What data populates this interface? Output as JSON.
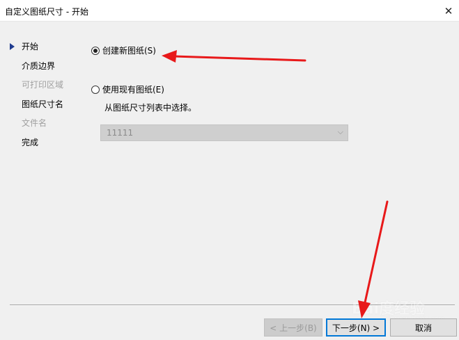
{
  "window": {
    "title": "自定义图纸尺寸 - 开始",
    "close_glyph": "✕"
  },
  "steps": [
    {
      "label": "开始",
      "state": "current"
    },
    {
      "label": "介质边界",
      "state": "enabled"
    },
    {
      "label": "可打印区域",
      "state": "disabled"
    },
    {
      "label": "图纸尺寸名",
      "state": "enabled"
    },
    {
      "label": "文件名",
      "state": "disabled"
    },
    {
      "label": "完成",
      "state": "enabled"
    }
  ],
  "options": {
    "create_new": {
      "label": "创建新图纸(S)",
      "checked": true
    },
    "use_existing": {
      "label": "使用现有图纸(E)",
      "checked": false
    },
    "hint": "从图纸尺寸列表中选择。",
    "existing_select": {
      "value": "11111",
      "enabled": false
    }
  },
  "buttons": {
    "back": "< 上一步(B)",
    "next": "下一步(N) >",
    "cancel": "取消"
  },
  "watermark": {
    "text": "Bai度经验",
    "sub": "jingyan.baidu.com"
  },
  "annotation_color": "#e8191a",
  "accent_color": "#0078d7"
}
